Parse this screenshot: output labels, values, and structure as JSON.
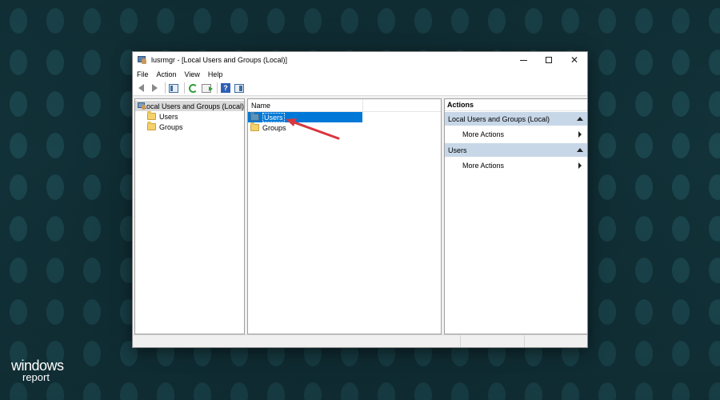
{
  "window": {
    "title": "lusrmgr - [Local Users and Groups (Local)]",
    "controls": {
      "minimize": "",
      "maximize": "",
      "close": "✕"
    }
  },
  "menu": [
    "File",
    "Action",
    "View",
    "Help"
  ],
  "toolbar": {
    "help_glyph": "?",
    "icons": [
      "back-arrow-icon",
      "forward-arrow-icon",
      "show-hide-tree-icon",
      "refresh-icon",
      "export-list-icon",
      "help-icon",
      "properties-icon"
    ]
  },
  "tree": {
    "root": "Local Users and Groups (Local)",
    "children": [
      "Users",
      "Groups"
    ]
  },
  "list": {
    "column_name": "Name",
    "rows": [
      {
        "label": "Users",
        "selected": true
      },
      {
        "label": "Groups",
        "selected": false
      }
    ]
  },
  "actions": {
    "header": "Actions",
    "sections": [
      {
        "title": "Local Users and Groups (Local)",
        "items": [
          "More Actions"
        ]
      },
      {
        "title": "Users",
        "items": [
          "More Actions"
        ]
      }
    ]
  },
  "annotation": {
    "arrow_color": "#d9363e"
  },
  "logo": {
    "top": "windows",
    "bottom": "report"
  },
  "colors": {
    "selection": "#0078d7",
    "section_band": "#c7d7e8",
    "desktop": "#12333a"
  }
}
